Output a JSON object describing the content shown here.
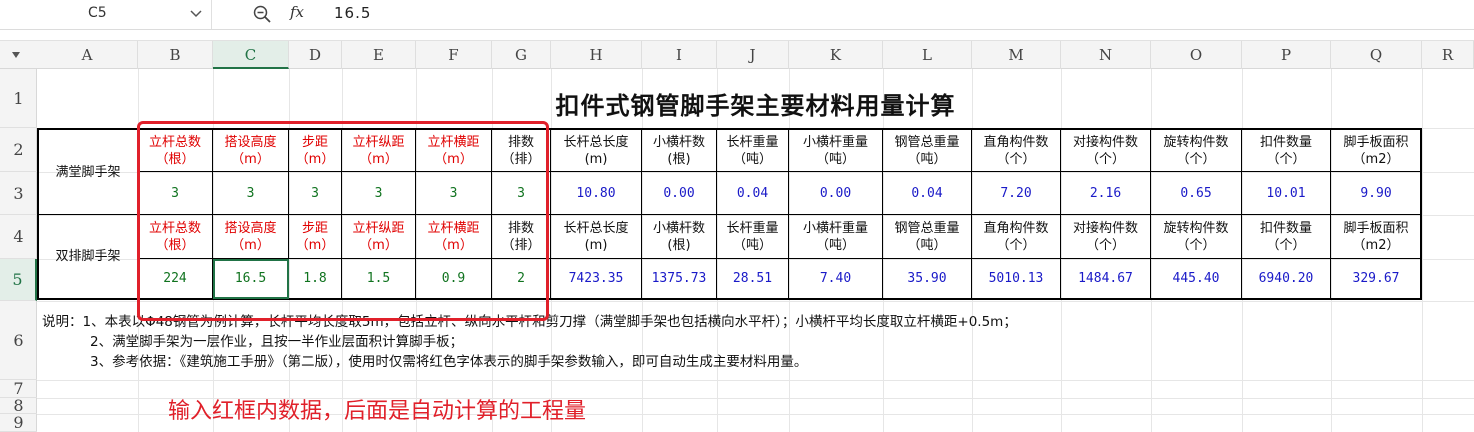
{
  "formula_bar": {
    "cell_ref": "C5",
    "formula": "16.5",
    "zoom_icon": "zoom-out-icon",
    "fx_label": "fx"
  },
  "columns": [
    "A",
    "B",
    "C",
    "D",
    "E",
    "F",
    "G",
    "H",
    "I",
    "J",
    "K",
    "L",
    "M",
    "N",
    "O",
    "P",
    "Q",
    "R"
  ],
  "selected_column": "C",
  "rows": [
    "1",
    "2",
    "3",
    "4",
    "5",
    "6",
    "7",
    "8",
    "9"
  ],
  "selected_row": "5",
  "sheet": {
    "title": "扣件式钢管脚手架主要材料用量计算",
    "full_scaffold": {
      "label": "满堂脚手架",
      "headers": [
        {
          "l1": "立杆总数",
          "l2": "（根）",
          "red": true
        },
        {
          "l1": "搭设高度",
          "l2": "（m）",
          "red": true
        },
        {
          "l1": "步距",
          "l2": "（m）",
          "red": true
        },
        {
          "l1": "立杆纵距",
          "l2": "（m）",
          "red": true
        },
        {
          "l1": "立杆横距",
          "l2": "（m）",
          "red": true
        },
        {
          "l1": "排数",
          "l2": "（排）",
          "red": false
        },
        {
          "l1": "长杆总长度",
          "l2": "(m)",
          "red": false
        },
        {
          "l1": "小横杆数",
          "l2": "(根)",
          "red": false
        },
        {
          "l1": "长杆重量",
          "l2": "（吨）",
          "red": false
        },
        {
          "l1": "小横杆重量",
          "l2": "（吨）",
          "red": false
        },
        {
          "l1": "钢管总重量",
          "l2": "（吨）",
          "red": false
        },
        {
          "l1": "直角构件数",
          "l2": "（个）",
          "red": false
        },
        {
          "l1": "对接构件数",
          "l2": "（个）",
          "red": false
        },
        {
          "l1": "旋转构件数",
          "l2": "（个）",
          "red": false
        },
        {
          "l1": "扣件数量",
          "l2": "（个）",
          "red": false
        },
        {
          "l1": "脚手板面积",
          "l2": "（m2）",
          "red": false
        }
      ],
      "values": [
        "3",
        "3",
        "3",
        "3",
        "3",
        "3",
        "10.80",
        "0.00",
        "0.04",
        "0.00",
        "0.04",
        "7.20",
        "2.16",
        "0.65",
        "10.01",
        "9.90"
      ]
    },
    "double_scaffold": {
      "label": "双排脚手架",
      "headers": [
        {
          "l1": "立杆总数",
          "l2": "（根）",
          "red": true
        },
        {
          "l1": "搭设高度",
          "l2": "（m）",
          "red": true
        },
        {
          "l1": "步距",
          "l2": "（m）",
          "red": true
        },
        {
          "l1": "立杆纵距",
          "l2": "（m）",
          "red": true
        },
        {
          "l1": "立杆横距",
          "l2": "（m）",
          "red": true
        },
        {
          "l1": "排数",
          "l2": "（排）",
          "red": false
        },
        {
          "l1": "长杆总长度",
          "l2": "(m)",
          "red": false
        },
        {
          "l1": "小横杆数",
          "l2": "(根)",
          "red": false
        },
        {
          "l1": "长杆重量",
          "l2": "（吨）",
          "red": false
        },
        {
          "l1": "小横杆重量",
          "l2": "（吨）",
          "red": false
        },
        {
          "l1": "钢管总重量",
          "l2": "（吨）",
          "red": false
        },
        {
          "l1": "直角构件数",
          "l2": "（个）",
          "red": false
        },
        {
          "l1": "对接构件数",
          "l2": "（个）",
          "red": false
        },
        {
          "l1": "旋转构件数",
          "l2": "（个）",
          "red": false
        },
        {
          "l1": "扣件数量",
          "l2": "（个）",
          "red": false
        },
        {
          "l1": "脚手板面积",
          "l2": "（m2）",
          "red": false
        }
      ],
      "values": [
        "224",
        "16.5",
        "1.8",
        "1.5",
        "0.9",
        "2",
        "7423.35",
        "1375.73",
        "28.51",
        "7.40",
        "35.90",
        "5010.13",
        "1484.67",
        "445.40",
        "6940.20",
        "329.67"
      ]
    },
    "notes": [
      "说明：1、本表以Φ48钢管为例计算，长杆平均长度取5m，包括立杆、纵向水平杆和剪刀撑（满堂脚手架也包括横向水平杆）；小横杆平均长度取立杆横距+0.5m；",
      "2、满堂脚手架为一层作业，且按一半作业层面积计算脚手板；",
      "3、参考依据：《建筑施工手册》（第二版），使用时仅需将红色字体表示的脚手架参数输入，即可自动生成主要材料用量。"
    ]
  },
  "annotation": "输入红框内数据，后面是自动计算的工程量",
  "colors": {
    "input_header": "#e00000",
    "input_value": "#10731f",
    "calc_value": "#1a1ac8",
    "highlight_box": "#e0202a",
    "selection": "#217346"
  }
}
